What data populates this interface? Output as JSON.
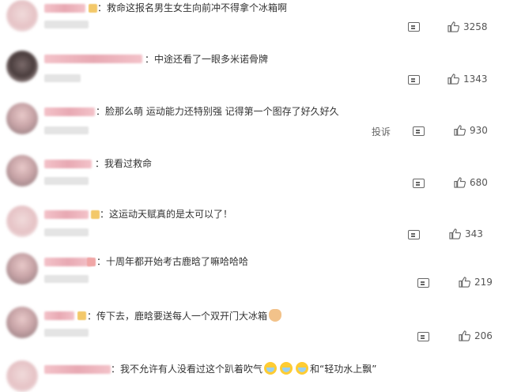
{
  "comments": [
    {
      "text": "：救命这报名男生女生向前冲不得拿个冰箱啊",
      "likes": "3258"
    },
    {
      "text": "：中途还看了一眼多米诺骨牌",
      "likes": "1343"
    },
    {
      "text": "：脸那么萌 运动能力还特别强 记得第一个图存了好久好久",
      "likes": "930",
      "report": "投诉"
    },
    {
      "text": "：我看过救命",
      "likes": "680"
    },
    {
      "text": "：这运动天赋真的是太可以了！",
      "likes": "343"
    },
    {
      "text": "：十周年都开始考古鹿晗了嘛哈哈哈",
      "likes": "219"
    },
    {
      "text": "：传下去，鹿晗要送每人一个双开门大冰箱",
      "likes": "206"
    },
    {
      "text_a": "：我不允许有人没看过这个趴着吹气",
      "text_b": "和“轻功水上飘”"
    }
  ],
  "icons": {
    "reply": "comment-icon",
    "like": "thumbs-up-icon",
    "cry": "crying-emoji",
    "cat": "cat-emoji"
  }
}
